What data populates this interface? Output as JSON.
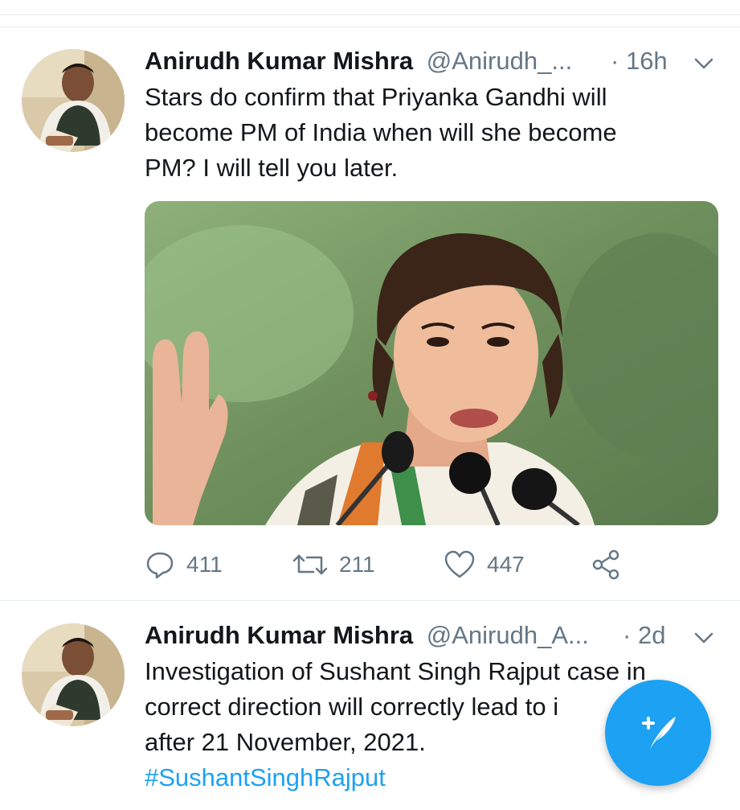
{
  "colors": {
    "accent": "#1da1f2",
    "secondary_text": "#657786",
    "primary_text": "#14171a",
    "divider": "#e6ecf0"
  },
  "tweets": [
    {
      "author_name": "Anirudh Kumar Mishra",
      "handle": "@Anirudh_...",
      "separator": "·",
      "time": "16h",
      "text_lines": [
        "Stars do confirm that Priyanka Gandhi will",
        "become PM of India when will she become",
        "PM? I will tell you later."
      ],
      "actions": {
        "replies": "411",
        "retweets": "211",
        "likes": "447"
      },
      "icons": [
        "reply-icon",
        "retweet-icon",
        "like-icon",
        "share-icon",
        "chevron-down-icon"
      ]
    },
    {
      "author_name": "Anirudh Kumar Mishra",
      "handle": "@Anirudh_A...",
      "separator": "·",
      "time": "2d",
      "text_lines": [
        "Investigation of Sushant Singh Rajput case in",
        "correct direction will correctly lead to i",
        "after 21 November, 2021."
      ],
      "hashtag": "#SushantSinghRajput",
      "icons": [
        "chevron-down-icon"
      ]
    }
  ],
  "compose_button": {
    "icon": "compose-tweet-icon"
  }
}
